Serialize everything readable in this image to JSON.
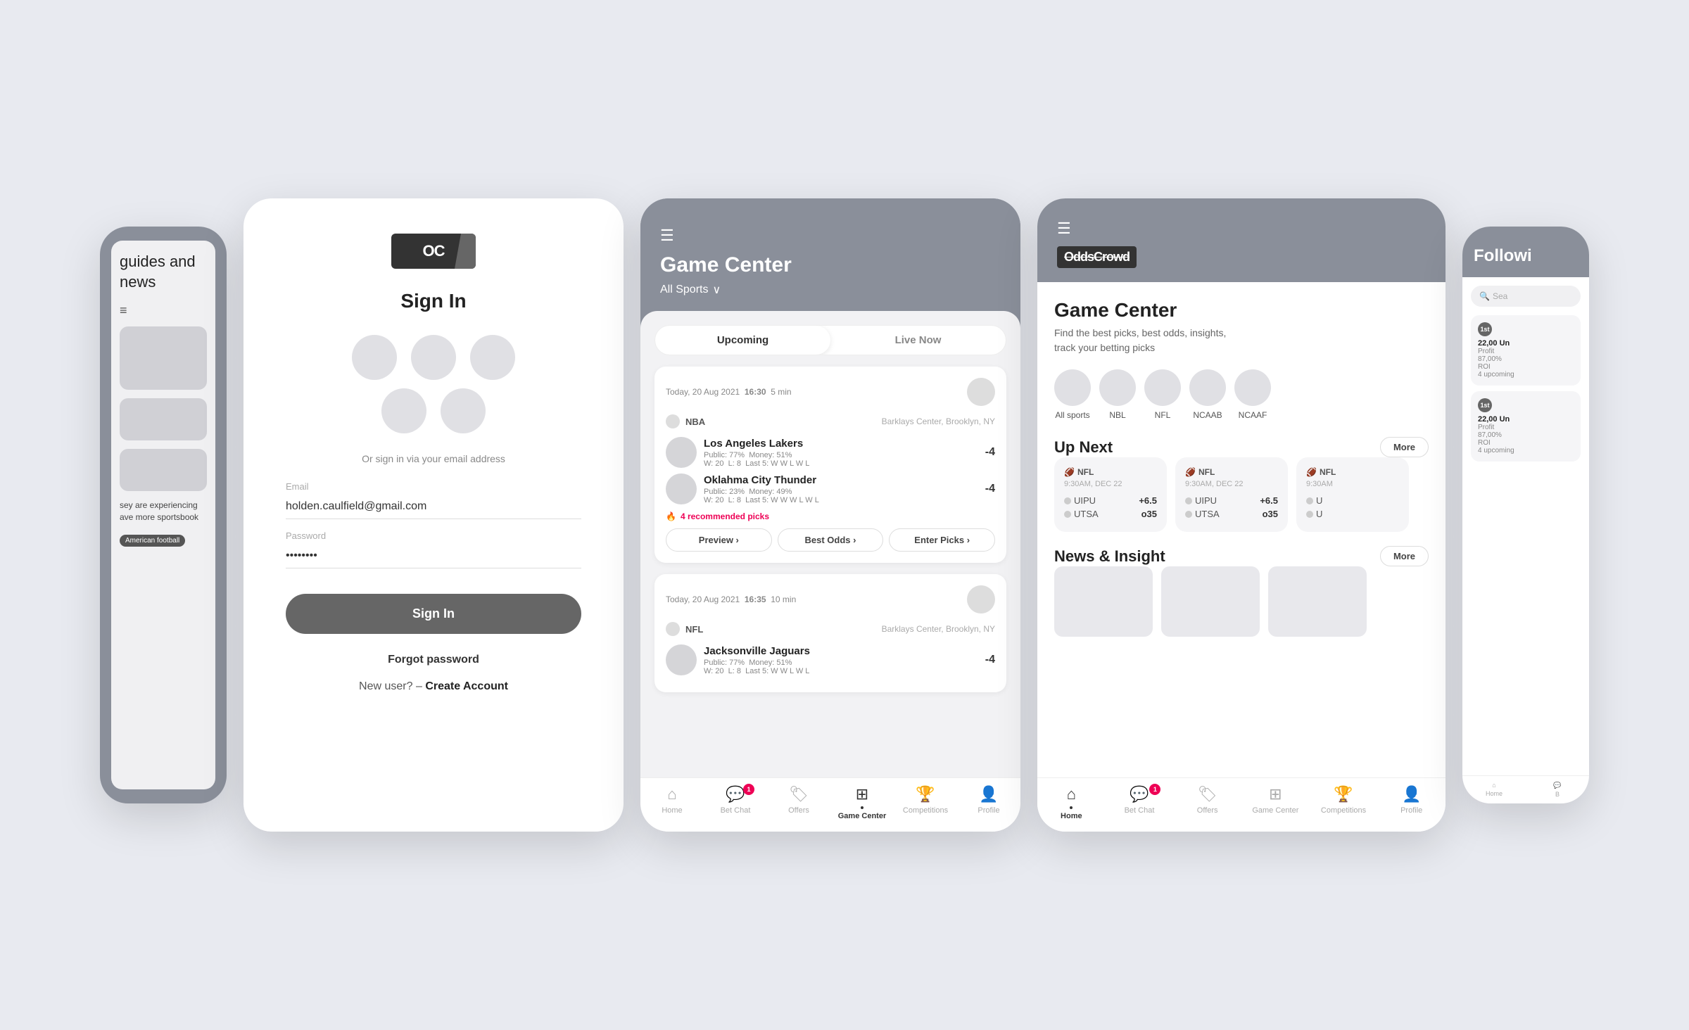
{
  "bg_color": "#e8eaf0",
  "screen1": {
    "title": "guides and news",
    "filter_icon": "≡",
    "tag": "American football"
  },
  "screen2": {
    "logo_text": "OC",
    "title": "Sign In",
    "or_text": "Or sign in via your email address",
    "email_label": "Email",
    "email_value": "holden.caulfield@gmail.com",
    "password_label": "Password",
    "password_value": "••••••••",
    "signin_btn": "Sign In",
    "forgot_pwd": "Forgot password",
    "new_user_text": "New user? –",
    "create_account": "Create Account"
  },
  "screen3": {
    "menu_icon": "☰",
    "title": "Game Center",
    "sports_filter": "All Sports",
    "tabs": {
      "upcoming": "Upcoming",
      "live_now": "Live Now"
    },
    "games": [
      {
        "date": "Today, 20 Aug 2021",
        "time": "16:30",
        "countdown": "5 min",
        "league": "NBA",
        "venue": "Barklays Center, Brooklyn, NY",
        "team1": {
          "name": "Los Angeles Lakers",
          "odds": "-4",
          "public": "77%",
          "money": "51%",
          "wins": "20",
          "losses": "8",
          "last5": "W W L W L"
        },
        "team2": {
          "name": "Oklahma City Thunder",
          "odds": "-4",
          "public": "23%",
          "money": "49%",
          "wins": "20",
          "losses": "8",
          "last5": "W W W L W L"
        },
        "picks": "4 recommended picks",
        "actions": [
          "Preview",
          "Best Odds",
          "Enter Picks"
        ]
      },
      {
        "date": "Today, 20 Aug 2021",
        "time": "16:35",
        "countdown": "10 min",
        "league": "NFL",
        "venue": "Barklays Center, Brooklyn, NY",
        "team1": {
          "name": "Jacksonville Jaguars",
          "odds": "-4",
          "public": "77%",
          "money": "51%",
          "wins": "20",
          "losses": "8",
          "last5": "W W L W L"
        }
      }
    ],
    "nav": {
      "home": "Home",
      "bet_chat": "Bet Chat",
      "offers": "Offers",
      "game_center": "Game Center",
      "competitions": "Competitions",
      "profile": "Profile"
    }
  },
  "screen4": {
    "menu_icon": "☰",
    "logo_text": "OddsCrowd",
    "title": "Game Center",
    "desc": "Find the best picks, best odds, insights,\ntrack your betting picks",
    "sports": [
      "All sports",
      "NBL",
      "NFL",
      "NCAAB",
      "NCAAF"
    ],
    "up_next": {
      "title": "Up Next",
      "more": "More",
      "cards": [
        {
          "league": "NFL",
          "time": "9:30AM, DEC 22",
          "picks": [
            {
              "label": "UIPU",
              "odds": "+6.5"
            },
            {
              "label": "UTSA",
              "odds": "o35"
            }
          ]
        },
        {
          "league": "NFL",
          "time": "9:30AM, DEC 22",
          "picks": [
            {
              "label": "UIPU",
              "odds": "+6.5"
            },
            {
              "label": "UTSA",
              "odds": "o35"
            }
          ]
        },
        {
          "league": "NFL",
          "time": "9:30AM",
          "picks": [
            {
              "label": "U",
              "odds": ""
            },
            {
              "label": "U",
              "odds": ""
            }
          ]
        }
      ]
    },
    "news_insight": {
      "title": "News & Insight",
      "more": "More"
    },
    "nav": {
      "home": "Home",
      "bet_chat": "Bet Chat",
      "offers": "Offers",
      "game_center": "Game Center",
      "competitions": "Competitions",
      "profile": "Profile"
    },
    "following_cards": [
      {
        "badge": "1st",
        "title": "22,00 Un",
        "profit": "Profit",
        "roi": "87,00%",
        "roi_label": "ROI",
        "upcoming": "4 upcom"
      },
      {
        "badge": "1st",
        "title": "22,00 Un",
        "profit": "Profit",
        "roi": "87,00%",
        "roi_label": "ROI",
        "upcoming": "4 upcom"
      }
    ]
  },
  "screen5": {
    "title": "Followi",
    "search_placeholder": "Sea",
    "cards": [
      {
        "badge": "1st",
        "title": "22,00 Un",
        "profit": "Profit",
        "roi": "87,00%",
        "upcoming": "4 upcoming"
      },
      {
        "badge": "1st",
        "title": "22,00 Un",
        "profit": "Profit",
        "roi": "87,00%",
        "upcoming": "4 upcoming"
      }
    ],
    "nav": {
      "home": "Home",
      "bet_chat": "B"
    }
  }
}
